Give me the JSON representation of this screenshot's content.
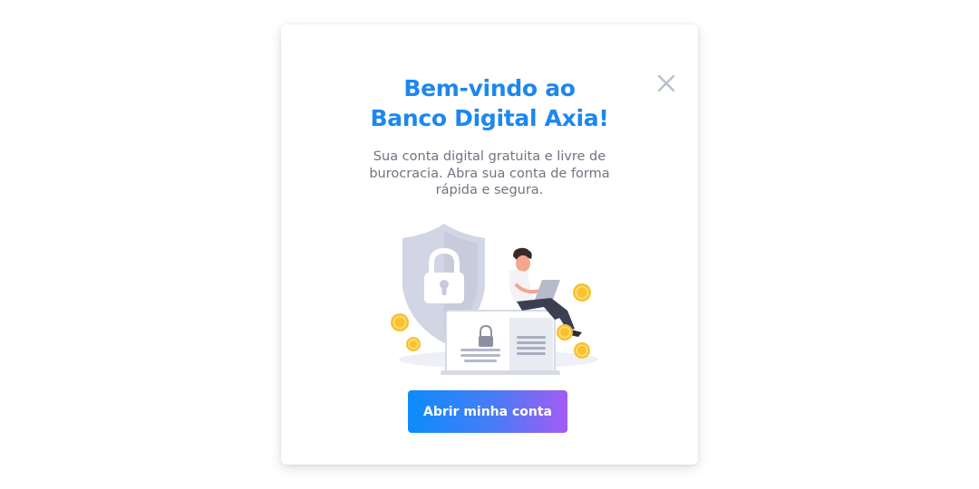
{
  "modal": {
    "title_line1": "Bem-vindo ao",
    "title_line2": "Banco Digital Axia!",
    "subtitle": "Sua conta digital gratuita e livre de burocracia. Abra sua conta de forma rápida e segura.",
    "close_icon": "close-icon",
    "illustration": "security-shield-lock-person-laptop-coins-illustration",
    "cta_label": "Abrir minha conta"
  },
  "colors": {
    "title": "#1d87f0",
    "subtitle": "#6f7480",
    "close_icon": "#b9c0cf",
    "cta_gradient_start": "#0c8cfb",
    "cta_gradient_end": "#a35cf3",
    "coin": "#f7c22e",
    "shield": "#d2d5e3"
  }
}
